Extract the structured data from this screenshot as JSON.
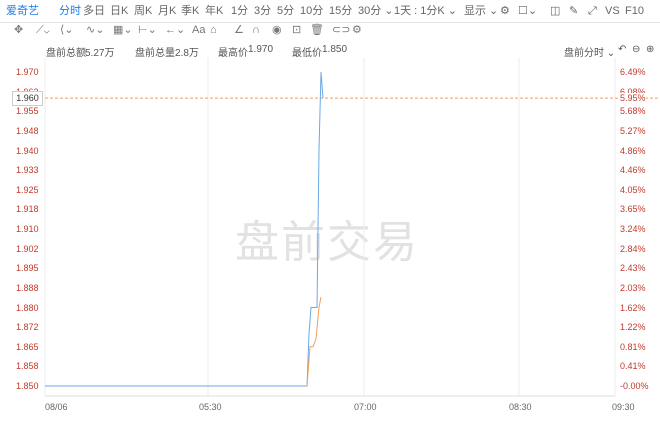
{
  "toolbar": {
    "symbol": "爱奇艺",
    "tabs": [
      "分时",
      "多日",
      "日K",
      "周K",
      "月K",
      "季K",
      "年K",
      "1分",
      "3分",
      "5分",
      "10分",
      "15分",
      "30分 ⌄",
      "1天 : 1分K ⌄"
    ],
    "display": "显示 ⌄",
    "compare": "VS",
    "f10": "F10"
  },
  "stats": {
    "premarket_amount_label": "盘前总额",
    "premarket_amount": "5.27万",
    "premarket_volume_label": "盘前总量",
    "premarket_volume": "2.8万",
    "high_label": "最高价",
    "high": "1.970",
    "low_label": "最低价",
    "low": "1.850",
    "mode": "盘前分时 ⌄"
  },
  "chart_data": {
    "type": "line",
    "watermark": "盘前交易",
    "current_price": "1.960",
    "y_left_ticks": [
      "1.970",
      "1.963",
      "1.955",
      "1.948",
      "1.940",
      "1.933",
      "1.925",
      "1.918",
      "1.910",
      "1.902",
      "1.895",
      "1.888",
      "1.880",
      "1.872",
      "1.865",
      "1.858",
      "1.850"
    ],
    "y_right_ticks": [
      "6.49%",
      "6.08%",
      "5.68%",
      "5.27%",
      "4.86%",
      "4.46%",
      "4.05%",
      "3.65%",
      "3.24%",
      "2.84%",
      "2.43%",
      "2.03%",
      "1.62%",
      "1.22%",
      "0.81%",
      "0.41%",
      "-0.00%"
    ],
    "current_pct": "5.95%",
    "x_ticks": [
      "08/06",
      "05:30",
      "07:00",
      "08:30",
      "09:30"
    ],
    "ylim": [
      1.85,
      1.97
    ],
    "series": [
      {
        "color": "#6aa8e8",
        "points": [
          [
            0,
            1.85
          ],
          [
            262,
            1.85
          ],
          [
            264,
            1.87
          ],
          [
            266,
            1.88
          ],
          [
            270,
            1.88
          ],
          [
            272,
            1.88
          ],
          [
            273,
            1.91
          ],
          [
            274,
            1.94
          ],
          [
            276,
            1.97
          ],
          [
            277,
            1.965
          ],
          [
            278,
            1.96
          ]
        ]
      },
      {
        "color": "#f0a05a",
        "points": [
          [
            262,
            1.85
          ],
          [
            265,
            1.865
          ],
          [
            268,
            1.865
          ],
          [
            271,
            1.868
          ],
          [
            274,
            1.88
          ],
          [
            276,
            1.884
          ]
        ]
      }
    ]
  }
}
